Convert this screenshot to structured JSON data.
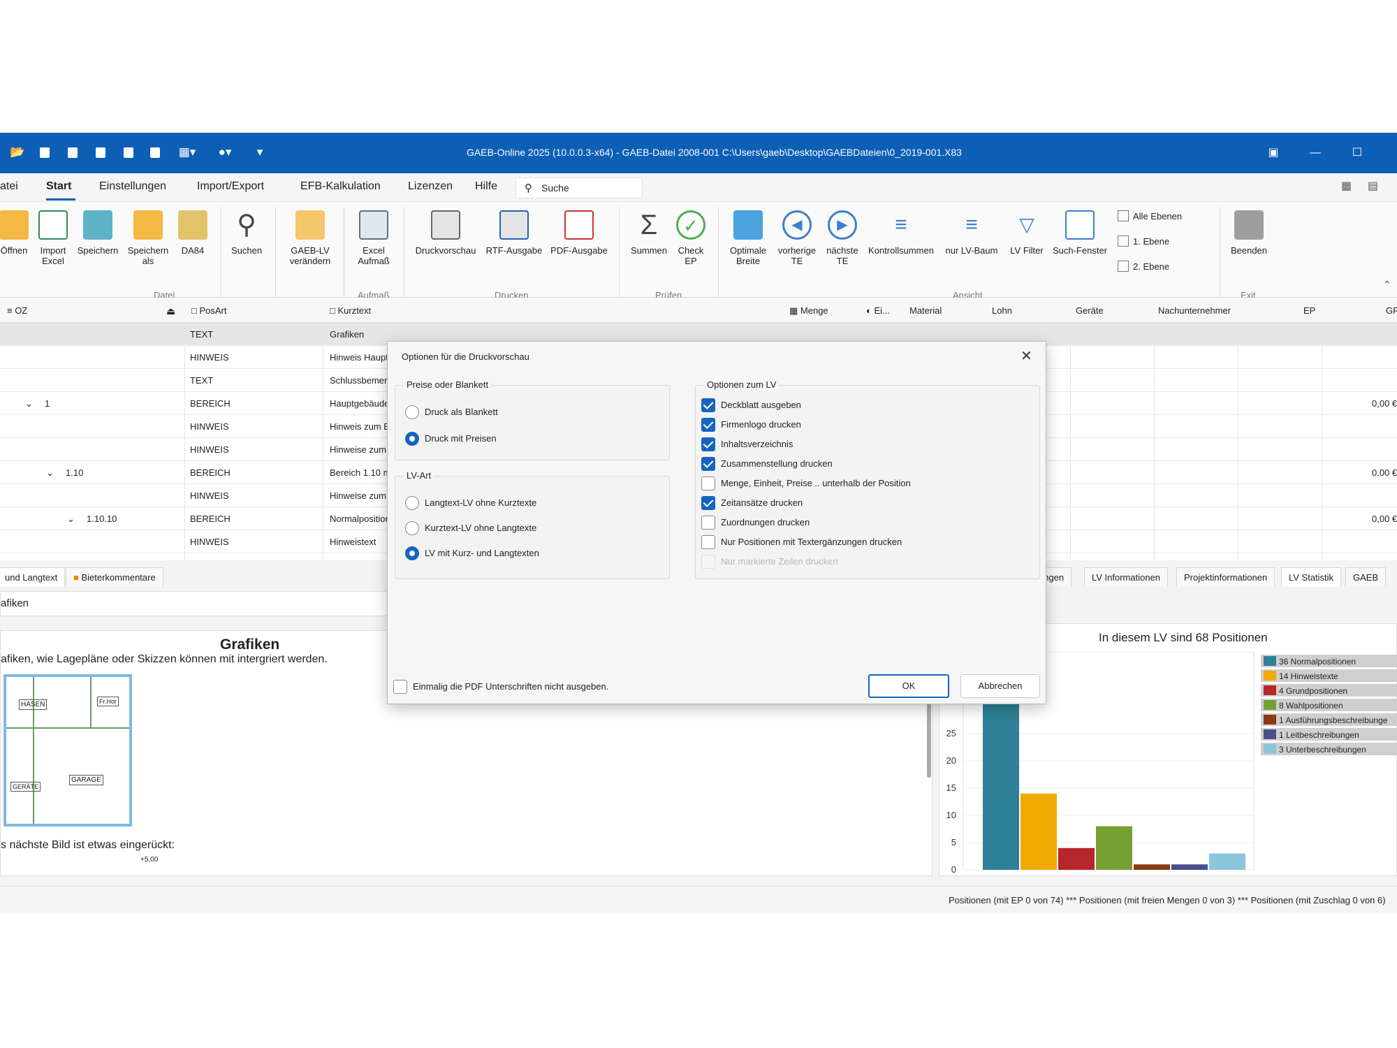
{
  "window": {
    "title": "GAEB-Online 2025 (10.0.0.3-x64) - GAEB-Datei  2008-001 C:\\Users\\gaeb\\Desktop\\GAEBDateien\\0_2019-001.X83"
  },
  "menu": {
    "items": [
      "atei",
      "Start",
      "Einstellungen",
      "Import/Export",
      "EFB-Kalkulation",
      "Lizenzen",
      "Hilfe"
    ],
    "search_placeholder": "Suche"
  },
  "ribbon": {
    "buttons": [
      {
        "label": "Öffnen",
        "icon": "folder-open-icon"
      },
      {
        "label": "Import Excel",
        "icon": "excel-import-icon"
      },
      {
        "label": "Speichern",
        "icon": "save-icon"
      },
      {
        "label": "Speichern als",
        "icon": "save-as-icon"
      },
      {
        "label": "DA84",
        "icon": "da84-icon"
      },
      {
        "label": "Suchen",
        "icon": "search-icon"
      },
      {
        "label": "GAEB-LV verändern",
        "icon": "edit-document-icon"
      },
      {
        "label": "Excel Aufmaß",
        "icon": "calculator-icon"
      },
      {
        "label": "Druckvorschau",
        "icon": "print-preview-icon"
      },
      {
        "label": "RTF-Ausgabe",
        "icon": "rtf-icon"
      },
      {
        "label": "PDF-Ausgabe",
        "icon": "pdf-icon"
      },
      {
        "label": "Summen",
        "icon": "sum-icon"
      },
      {
        "label": "Check EP",
        "icon": "check-icon"
      },
      {
        "label": "Optimale Breite",
        "icon": "column-width-icon"
      },
      {
        "label": "vorherige TE",
        "icon": "previous-icon"
      },
      {
        "label": "nächste TE",
        "icon": "next-icon"
      },
      {
        "label": "Kontrollsummen",
        "icon": "checksum-icon"
      },
      {
        "label": "nur LV-Baum",
        "icon": "tree-icon"
      },
      {
        "label": "LV Filter",
        "icon": "filter-icon"
      },
      {
        "label": "Such-Fenster",
        "icon": "search-window-icon"
      },
      {
        "label": "Beenden",
        "icon": "exit-icon"
      }
    ],
    "small_buttons": [
      "Alle Ebenen",
      "1. Ebene",
      "2. Ebene"
    ],
    "groups": [
      "Datei",
      "Aufmaß",
      "Drucken",
      "Prüfen",
      "Ansicht",
      "Exit"
    ]
  },
  "grid": {
    "columns": [
      "OZ",
      "PosArt",
      "Kurztext",
      "Menge",
      "Ei...",
      "Material",
      "Lohn",
      "Geräte",
      "Nachunternehmer",
      "EP",
      "GP"
    ],
    "rows": [
      {
        "oz": "",
        "posart": "TEXT",
        "kurztext": "Grafiken",
        "gp": ""
      },
      {
        "oz": "",
        "posart": "HINWEIS",
        "kurztext": "Hinweis Haupt",
        "gp": ""
      },
      {
        "oz": "",
        "posart": "TEXT",
        "kurztext": "Schlussbemerk",
        "gp": ""
      },
      {
        "oz": "1",
        "posart": "BEREICH",
        "kurztext": "Hauptgebäude",
        "gp": "0,00 €"
      },
      {
        "oz": "",
        "posart": "HINWEIS",
        "kurztext": "Hinweis zum E",
        "gp": ""
      },
      {
        "oz": "",
        "posart": "HINWEIS",
        "kurztext": "Hinweise zum",
        "gp": ""
      },
      {
        "oz": "1.10",
        "posart": "BEREICH",
        "kurztext": "Bereich 1.10 m",
        "gp": "0,00 €"
      },
      {
        "oz": "",
        "posart": "HINWEIS",
        "kurztext": "Hinweise zum",
        "gp": ""
      },
      {
        "oz": "1.10.10",
        "posart": "BEREICH",
        "kurztext": "Normalposition",
        "gp": "0,00 €"
      },
      {
        "oz": "",
        "posart": "HINWEIS",
        "kurztext": "Hinweistext",
        "gp": ""
      }
    ]
  },
  "lower": {
    "left_tabs": [
      "und Langtext",
      "Bieterkommentare"
    ],
    "right_tabs": [
      "ungen",
      "LV Informationen",
      "Projektinformationen",
      "LV Statistik",
      "GAEB"
    ],
    "field_value": "afiken",
    "preview": {
      "heading": "Grafiken",
      "line1": "afiken, wie Lagepläne oder Skizzen können mit intergriert werden.",
      "line2": "s nächste Bild ist etwas eingerückt:",
      "sketch_labels": [
        "HASEN",
        "Fr.Hor",
        "GARAGE",
        "GERÄTE",
        "+5,00"
      ]
    }
  },
  "chart_data": {
    "type": "bar",
    "title": "In diesem LV sind 68 Positionen",
    "categories": [
      "Normalpositionen",
      "Hinweistexte",
      "Grundpositionen",
      "Wahlpositionen",
      "Ausführungsbeschreibungen",
      "Leitbeschreibungen",
      "Unterbeschreibungen"
    ],
    "values": [
      36,
      14,
      4,
      8,
      1,
      1,
      3
    ],
    "legend_labels": [
      "36 Normalpositionen",
      "14 Hinweistexte",
      "4 Grundpositionen",
      "8 Wahlpositionen",
      "1 Ausführungsbeschreibunge",
      "1 Leitbeschreibungen",
      "3 Unterbeschreibungen"
    ],
    "colors": [
      "#2e8096",
      "#f0aa00",
      "#b7262b",
      "#77a032",
      "#8a3a10",
      "#4a4f8c",
      "#8ac7dc"
    ],
    "ylim": [
      0,
      40
    ],
    "yticks": [
      0,
      5,
      10,
      15,
      20,
      25
    ],
    "legend_position": "right"
  },
  "status": {
    "text": "Positionen (mit EP 0 von 74) *** Positionen (mit freien Mengen 0 von 3) *** Positionen (mit Zuschlag 0 von 6)"
  },
  "dialog": {
    "title": "Optionen für die Druckvorschau",
    "group_prices": {
      "legend": "Preise oder Blankett",
      "options": [
        {
          "label": "Druck als Blankett",
          "selected": false
        },
        {
          "label": "Druck mit Preisen",
          "selected": true
        }
      ]
    },
    "group_lvart": {
      "legend": "LV-Art",
      "options": [
        {
          "label": "Langtext-LV ohne Kurztexte",
          "selected": false
        },
        {
          "label": "Kurztext-LV ohne Langtexte",
          "selected": false
        },
        {
          "label": "LV mit Kurz- und Langtexten",
          "selected": true
        }
      ]
    },
    "group_options": {
      "legend": "Optionen zum LV",
      "options": [
        {
          "label": "Deckblatt ausgeben",
          "checked": true,
          "disabled": false
        },
        {
          "label": "Firmenlogo drucken",
          "checked": true,
          "disabled": false
        },
        {
          "label": "Inhaltsverzeichnis",
          "checked": true,
          "disabled": false
        },
        {
          "label": "Zusammenstellung drucken",
          "checked": true,
          "disabled": false
        },
        {
          "label": "Menge, Einheit, Preise .. unterhalb der Position",
          "checked": false,
          "disabled": false
        },
        {
          "label": "Zeitansätze drucken",
          "checked": true,
          "disabled": false
        },
        {
          "label": "Zuordnungen drucken",
          "checked": false,
          "disabled": false
        },
        {
          "label": "Nur Positionen mit Textergänzungen drucken",
          "checked": false,
          "disabled": false
        },
        {
          "label": "Nur markierte Zeilen drucken",
          "checked": false,
          "disabled": true
        }
      ]
    },
    "bottom_checkbox": "Einmalig die PDF Unterschriften nicht ausgeben.",
    "ok_label": "OK",
    "cancel_label": "Abbrechen"
  }
}
